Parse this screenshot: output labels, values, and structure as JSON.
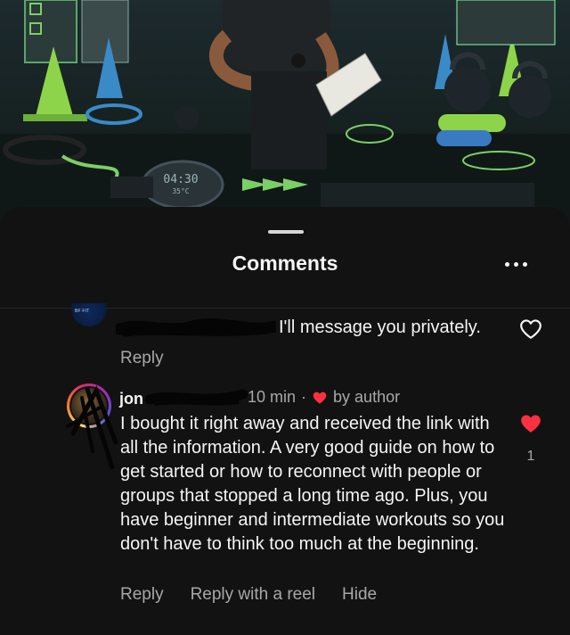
{
  "background_image": {
    "timer": "04:30",
    "timer_sub": "35°C"
  },
  "sheet": {
    "title": "Comments",
    "more_icon": "more-horizontal-icon"
  },
  "comments": [
    {
      "username_visible": "",
      "text": "I'll message you privately.",
      "reply_label": "Reply",
      "liked": false
    },
    {
      "username_visible": "jon",
      "time": "10 min",
      "separator": "·",
      "author_badge": "by author",
      "text": "I bought it right away and received the link with all the information. A very good guide on how to get started or how to reconnect with people or groups that stopped a long time ago. Plus, you have beginner and intermediate workouts so you don't have to think too much at the beginning.",
      "likes": "1",
      "liked": true,
      "actions": {
        "reply": "Reply",
        "reply_with_reel": "Reply with a reel",
        "hide": "Hide"
      }
    }
  ],
  "colors": {
    "sheet_bg": "#121212",
    "text_primary": "#f5f5f5",
    "text_secondary": "#a8a8a8",
    "like_red": "#ff3040"
  }
}
